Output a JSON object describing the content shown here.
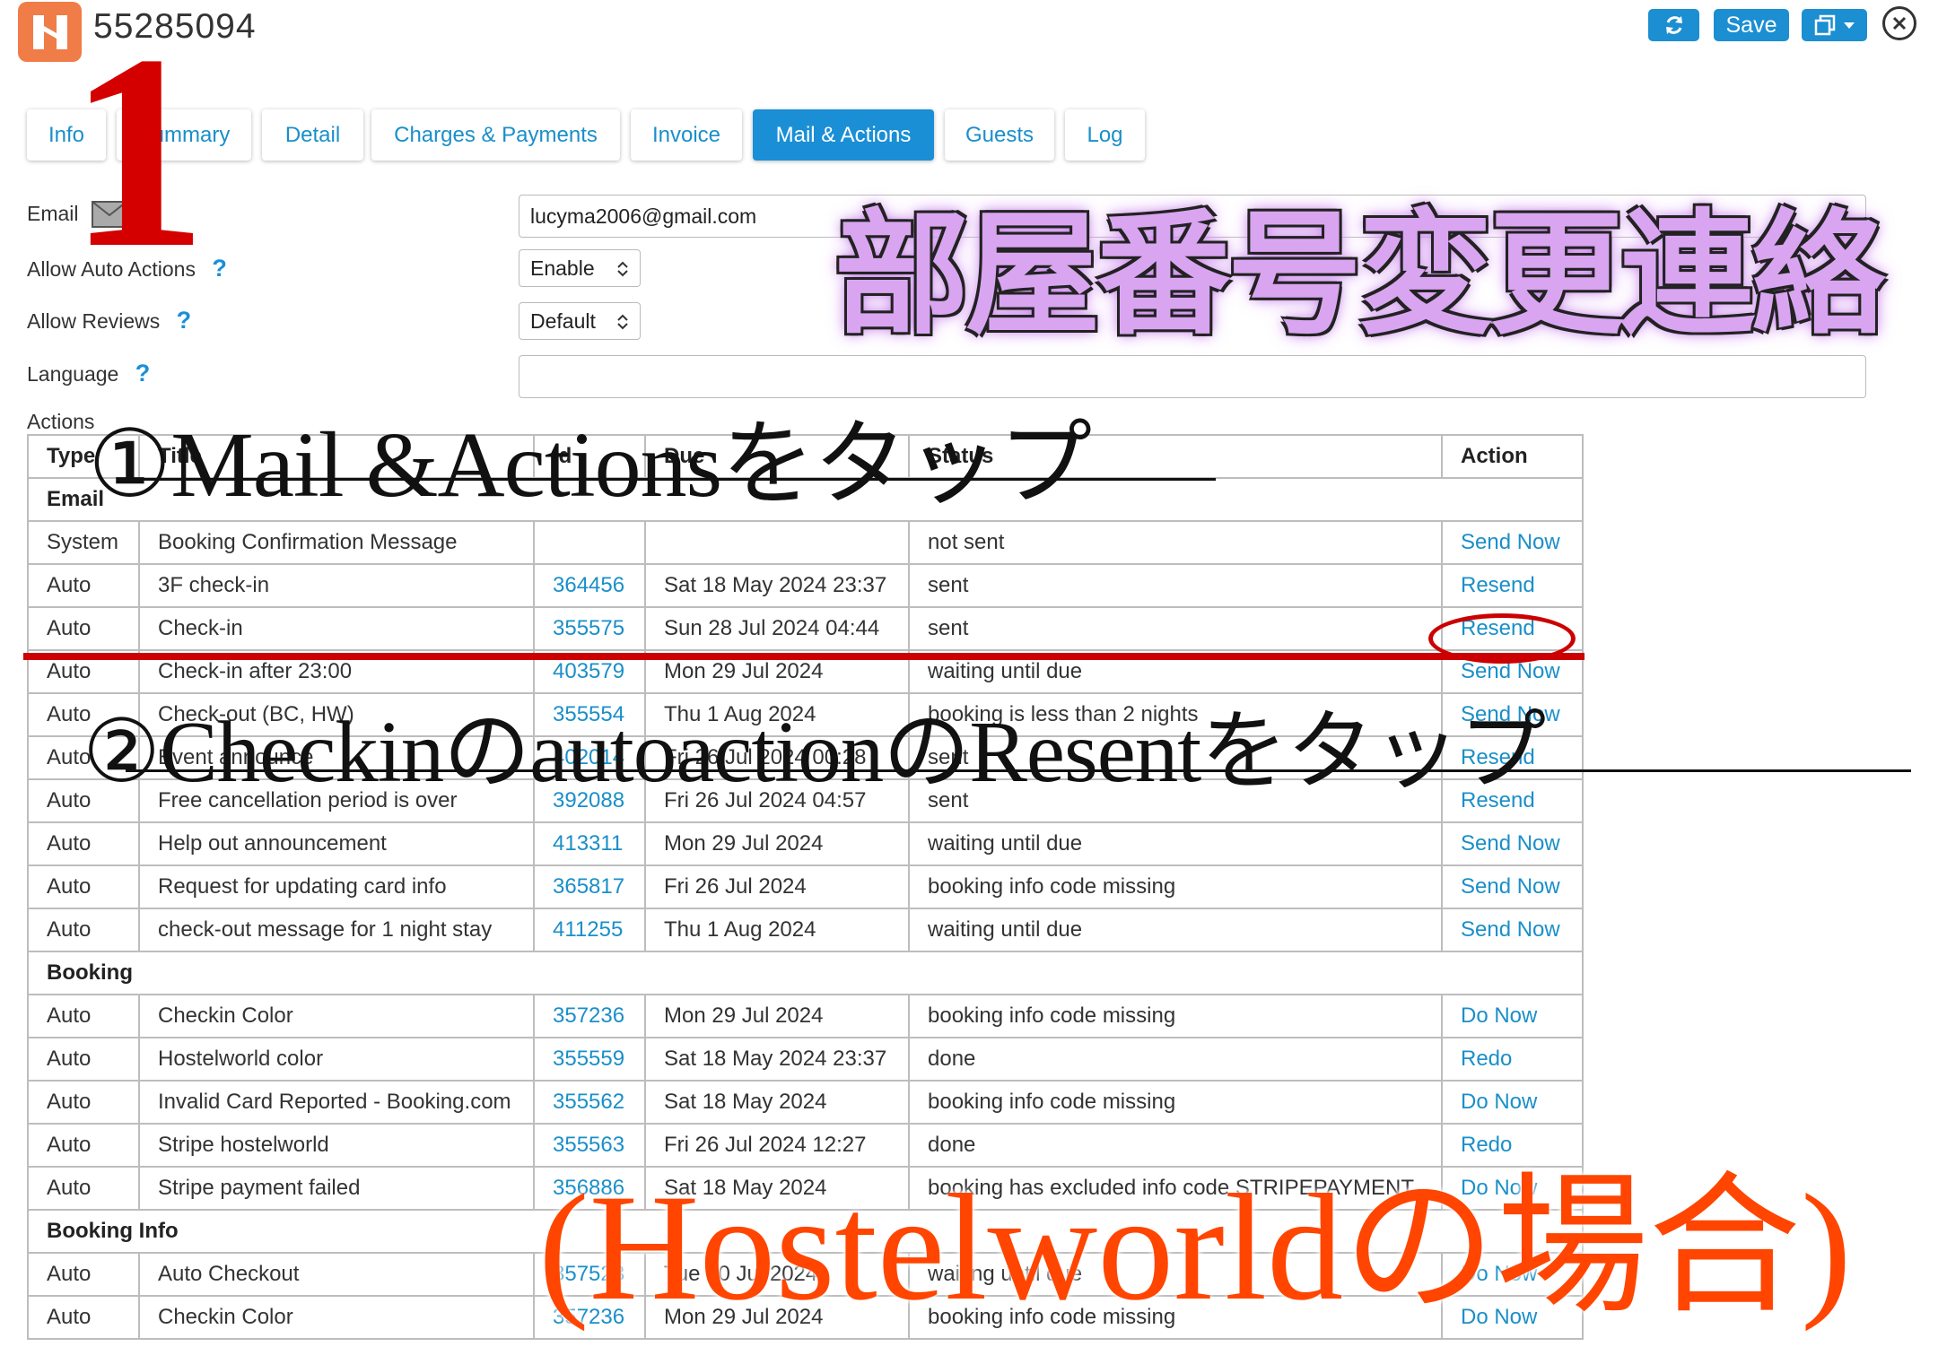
{
  "header": {
    "booking_id": "55285094",
    "save_label": "Save"
  },
  "tabs": [
    "Info",
    "Summary",
    "Detail",
    "Charges & Payments",
    "Invoice",
    "Mail & Actions",
    "Guests",
    "Log"
  ],
  "active_tab": "Mail & Actions",
  "settings": {
    "email_label": "Email",
    "email_value": "lucyma2006@gmail.com",
    "auto_actions_label": "Allow Auto Actions",
    "auto_actions_value": "Enable",
    "reviews_label": "Allow Reviews",
    "reviews_value": "Default",
    "language_label": "Language",
    "language_value": "",
    "help_mark": "?"
  },
  "actions_label": "Actions",
  "table": {
    "headers": [
      "Type",
      "Title",
      "Id",
      "Due",
      "Status",
      "Action"
    ],
    "sections": [
      {
        "name": "Email",
        "rows": [
          [
            "System",
            "Booking Confirmation Message",
            "",
            "",
            "not sent",
            "Send Now"
          ],
          [
            "Auto",
            "3F check-in",
            "364456",
            "Sat 18 May 2024 23:37",
            "sent",
            "Resend"
          ],
          [
            "Auto",
            "Check-in",
            "355575",
            "Sun 28 Jul 2024 04:44",
            "sent",
            "Resend"
          ],
          [
            "Auto",
            "Check-in after 23:00",
            "403579",
            "Mon 29 Jul 2024",
            "waiting until due",
            "Send Now"
          ],
          [
            "Auto",
            "Check-out (BC, HW)",
            "355554",
            "Thu 1 Aug 2024",
            "booking is less than 2 nights",
            "Send Now"
          ],
          [
            "Auto",
            "Event announce",
            "402014",
            "Fri 26 Jul 2024 00:28",
            "sent",
            "Resend"
          ],
          [
            "Auto",
            "Free cancellation period is over",
            "392088",
            "Fri 26 Jul 2024 04:57",
            "sent",
            "Resend"
          ],
          [
            "Auto",
            "Help out announcement",
            "413311",
            "Mon 29 Jul 2024",
            "waiting until due",
            "Send Now"
          ],
          [
            "Auto",
            "Request for updating card info",
            "365817",
            "Fri 26 Jul 2024",
            "booking info code missing",
            "Send Now"
          ],
          [
            "Auto",
            "check-out message for 1 night stay",
            "411255",
            "Thu 1 Aug 2024",
            "waiting until due",
            "Send Now"
          ]
        ]
      },
      {
        "name": "Booking",
        "rows": [
          [
            "Auto",
            "Checkin Color",
            "357236",
            "Mon 29 Jul 2024",
            "booking info code missing",
            "Do Now"
          ],
          [
            "Auto",
            "Hostelworld color",
            "355559",
            "Sat 18 May 2024 23:37",
            "done",
            "Redo"
          ],
          [
            "Auto",
            "Invalid Card Reported - Booking.com",
            "355562",
            "Sat 18 May 2024",
            "booking info code missing",
            "Do Now"
          ],
          [
            "Auto",
            "Stripe hostelworld",
            "355563",
            "Fri 26 Jul 2024 12:27",
            "done",
            "Redo"
          ],
          [
            "Auto",
            "Stripe payment failed",
            "356886",
            "Sat 18 May 2024",
            "booking has excluded info code STRIPEPAYMENT",
            "Do Now"
          ]
        ]
      },
      {
        "name": "Booking Info",
        "rows": [
          [
            "Auto",
            "Auto Checkout",
            "357523",
            "Tue 30 Jul 2024",
            "waiting until due",
            "Do Now"
          ],
          [
            "Auto",
            "Checkin Color",
            "357236",
            "Mon 29 Jul 2024",
            "booking info code missing",
            "Do Now"
          ]
        ]
      }
    ]
  },
  "annotations": {
    "step_number": "1",
    "title_jp": "部屋番号変更連絡",
    "step1": "①Mail &Actionsをタップ",
    "step2": "②CheckinのautoactionのResentをタップ",
    "note": "(Hostelworldの場合)"
  },
  "colors": {
    "accent": "#1a8fd6",
    "link": "#1a8fc9",
    "logo": "#f07c48",
    "annotation_red": "#cc0000",
    "annotation_orange": "#ff4500",
    "annotation_purple": "#d9a5f0"
  }
}
